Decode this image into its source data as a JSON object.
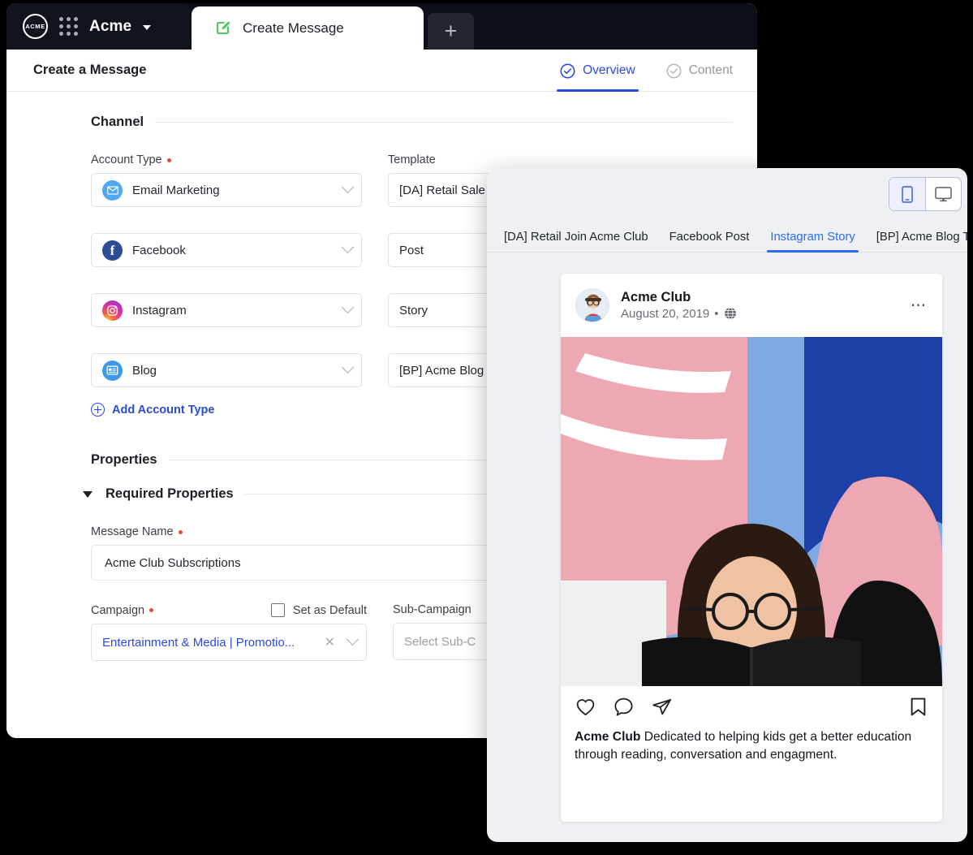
{
  "window": {
    "brand": "Acme",
    "tab_label": "Create Message",
    "new_tab_label": "+",
    "logo_text": "ACME"
  },
  "header": {
    "page_title": "Create a Message",
    "steps": [
      {
        "label": "Overview",
        "state": "active"
      },
      {
        "label": "Content",
        "state": "inactive"
      }
    ]
  },
  "channel": {
    "section_title": "Channel",
    "account_type_label": "Account Type",
    "template_label": "Template",
    "add_account_type": "Add Account Type",
    "rows": [
      {
        "account": "Email Marketing",
        "icon": "email-icon",
        "template": "[DA] Retail Sale"
      },
      {
        "account": "Facebook",
        "icon": "facebook-icon",
        "template": "Post"
      },
      {
        "account": "Instagram",
        "icon": "instagram-icon",
        "template": "Story"
      },
      {
        "account": "Blog",
        "icon": "blog-icon",
        "template": "[BP] Acme Blog"
      }
    ]
  },
  "properties": {
    "section_title": "Properties",
    "required_group_title": "Required Properties",
    "message_name_label": "Message Name",
    "message_name_value": "Acme Club Subscriptions",
    "campaign_label": "Campaign",
    "campaign_value": "Entertainment & Media | Promotio...",
    "set_as_default_label": "Set as Default",
    "sub_campaign_label": "Sub-Campaign",
    "sub_campaign_placeholder": "Select Sub-C"
  },
  "preview": {
    "tabs": [
      {
        "label": "[DA] Retail Join Acme Club",
        "active": false
      },
      {
        "label": "Facebook Post",
        "active": false
      },
      {
        "label": "Instagram Story",
        "active": true
      },
      {
        "label": "[BP] Acme Blog Template",
        "active": false
      }
    ],
    "device_toggle": {
      "mobile": "mobile-icon",
      "desktop": "desktop-icon",
      "selected": "mobile"
    },
    "post": {
      "account_name": "Acme Club",
      "date": "August 20, 2019",
      "visibility_icon": "globe-icon",
      "more_icon": "ellipsis-icon",
      "caption_author": "Acme Club",
      "caption_text": " Dedicated to helping kids get a better education through reading, conversation and engagment.",
      "actions": [
        "heart-icon",
        "comment-icon",
        "share-icon",
        "bookmark-icon"
      ]
    }
  },
  "colors": {
    "accent_blue": "#2b4bdb",
    "preview_blue": "#2b6ef0",
    "required_red": "#e0503c",
    "titlebar": "#0d0f17",
    "tab_green": "#4caf50"
  }
}
